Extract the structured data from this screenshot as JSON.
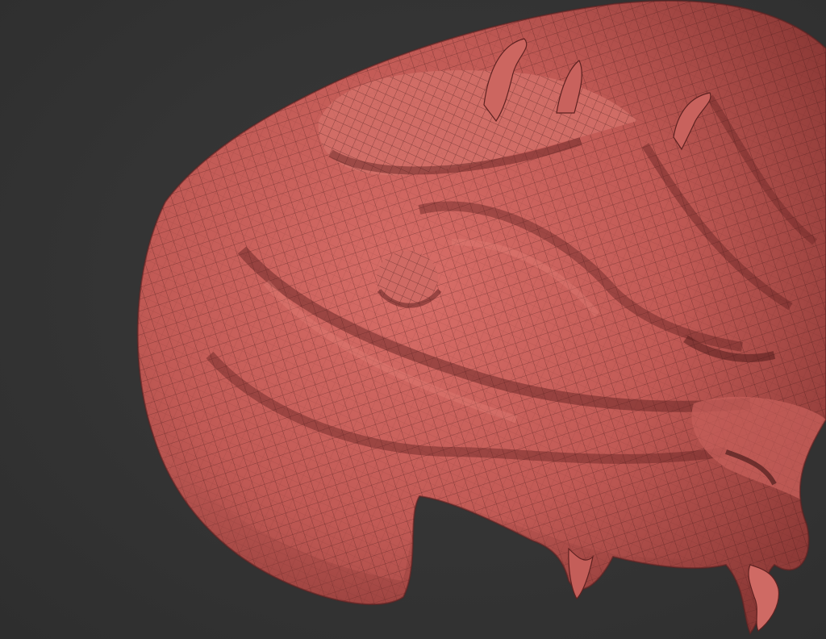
{
  "viewport": {
    "background_color": "#353535",
    "mesh_base_color": "#c4605c",
    "mesh_highlight_color": "#e07a74",
    "mesh_shadow_color": "#5a1e1e",
    "wire_color": "#3a1414",
    "display_mode": "polyframe"
  }
}
